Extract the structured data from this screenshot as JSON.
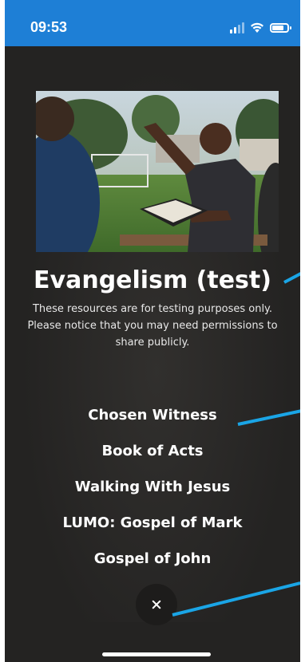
{
  "status_bar": {
    "time": "09:53",
    "icons": [
      "cellular-signal-icon",
      "wifi-icon",
      "battery-icon"
    ],
    "background_color": "#1e7fd6"
  },
  "hero": {
    "image_description": "hero-photo"
  },
  "resource": {
    "title": "Evangelism (test)",
    "description": "These resources are for testing purposes only. Please notice that you may need permissions to share publicly."
  },
  "menu": {
    "items": [
      {
        "label": "Chosen Witness"
      },
      {
        "label": "Book of Acts"
      },
      {
        "label": "Walking With Jesus"
      },
      {
        "label": "LUMO: Gospel of Mark"
      },
      {
        "label": "Gospel of John"
      }
    ]
  },
  "close": {
    "icon": "close-icon"
  },
  "colors": {
    "background": "#242322",
    "accent": "#1e7fd6",
    "annotation": "#1aa5e6",
    "text": "#ffffff"
  }
}
